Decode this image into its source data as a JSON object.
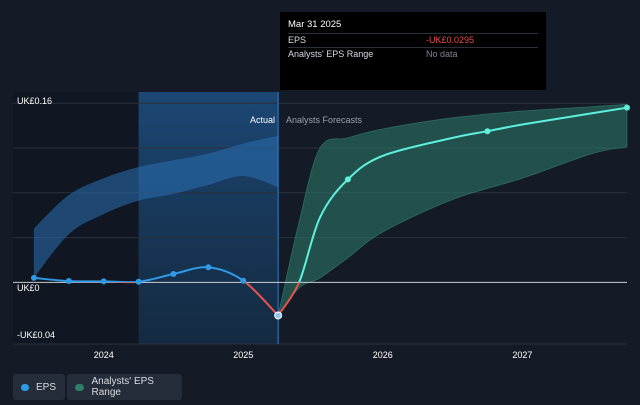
{
  "chart_data": {
    "type": "line",
    "y_axis_labels": [
      "UK£0.16",
      "UK£0",
      "-UK£0.04"
    ],
    "x_ticks": [
      {
        "label": "2024",
        "x": 2024.0
      },
      {
        "label": "2025",
        "x": 2025.0
      },
      {
        "label": "2026",
        "x": 2026.0
      },
      {
        "label": "2027",
        "x": 2027.0
      }
    ],
    "xlim": [
      2023.35,
      2027.75
    ],
    "ylim": [
      -0.055,
      0.17
    ],
    "divider_x": 2025.25,
    "highlight_from_x": 2024.25,
    "region_labels": {
      "actual": "Actual",
      "forecast": "Analysts Forecasts"
    },
    "eps_series": {
      "name": "EPS",
      "x": [
        2023.5,
        2023.75,
        2024.0,
        2024.25,
        2024.5,
        2024.75,
        2025.0,
        2025.25
      ],
      "y": [
        0.004,
        0.0012,
        0.0009,
        0.0006,
        0.0075,
        0.0135,
        0.0015,
        -0.0295
      ]
    },
    "forecast_series": {
      "x": [
        2025.25,
        2025.4,
        2025.55,
        2025.75,
        2026.0,
        2026.5,
        2026.75,
        2027.0,
        2027.5,
        2027.75
      ],
      "y": [
        -0.0295,
        0.0,
        0.058,
        0.092,
        0.113,
        0.129,
        0.135,
        0.141,
        0.151,
        0.156
      ]
    },
    "past_range_band": {
      "x": [
        2023.5,
        2023.75,
        2024.0,
        2024.25,
        2024.5,
        2024.75,
        2025.0,
        2025.25
      ],
      "upper": [
        0.048,
        0.078,
        0.093,
        0.103,
        0.109,
        0.115,
        0.124,
        0.131
      ],
      "lower": [
        0.004,
        0.043,
        0.061,
        0.073,
        0.079,
        0.087,
        0.095,
        0.085
      ]
    },
    "forecast_range_band": {
      "x": [
        2025.25,
        2025.4,
        2025.55,
        2025.75,
        2026.0,
        2026.5,
        2027.0,
        2027.5,
        2027.75
      ],
      "upper": [
        -0.0295,
        0.054,
        0.12,
        0.129,
        0.137,
        0.147,
        0.153,
        0.157,
        0.159
      ],
      "lower": [
        -0.0295,
        -0.005,
        0.004,
        0.022,
        0.045,
        0.074,
        0.093,
        0.115,
        0.121
      ]
    }
  },
  "tooltip": {
    "title": "Mar 31 2025",
    "rows": [
      {
        "label": "EPS",
        "value": "-UK£0.0295"
      },
      {
        "label": "Analysts' EPS Range",
        "value": "No data"
      }
    ]
  },
  "legend": {
    "eps_label": "EPS",
    "range_label": "Analysts' EPS Range"
  },
  "colors": {
    "background": "#151b26",
    "eps_line": "#2f9ae6",
    "negative_line": "#e5534b",
    "forecast_line": "#5ef0dc",
    "past_band": "#2a6fb2",
    "forecast_band": "#2e7e6e",
    "highlight": "#1b3a5e"
  }
}
